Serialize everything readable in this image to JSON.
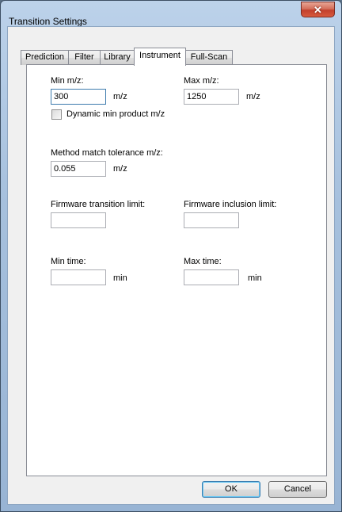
{
  "window": {
    "title": "Transition Settings",
    "close_icon": "close-icon"
  },
  "tabs": [
    {
      "label": "Prediction",
      "active": false
    },
    {
      "label": "Filter",
      "active": false
    },
    {
      "label": "Library",
      "active": false
    },
    {
      "label": "Instrument",
      "active": true
    },
    {
      "label": "Full-Scan",
      "active": false
    }
  ],
  "instrument": {
    "min_mz": {
      "label": "Min m/z:",
      "value": "300",
      "unit": "m/z"
    },
    "max_mz": {
      "label": "Max m/z:",
      "value": "1250",
      "unit": "m/z"
    },
    "dynamic_min": {
      "label": "Dynamic min product m/z",
      "checked": false
    },
    "method_match": {
      "label": "Method match tolerance m/z:",
      "value": "0.055",
      "unit": "m/z"
    },
    "firmware_transition": {
      "label": "Firmware transition limit:",
      "value": ""
    },
    "firmware_inclusion": {
      "label": "Firmware inclusion limit:",
      "value": ""
    },
    "min_time": {
      "label": "Min time:",
      "value": "",
      "unit": "min"
    },
    "max_time": {
      "label": "Max time:",
      "value": "",
      "unit": "min"
    }
  },
  "buttons": {
    "ok": "OK",
    "cancel": "Cancel"
  }
}
